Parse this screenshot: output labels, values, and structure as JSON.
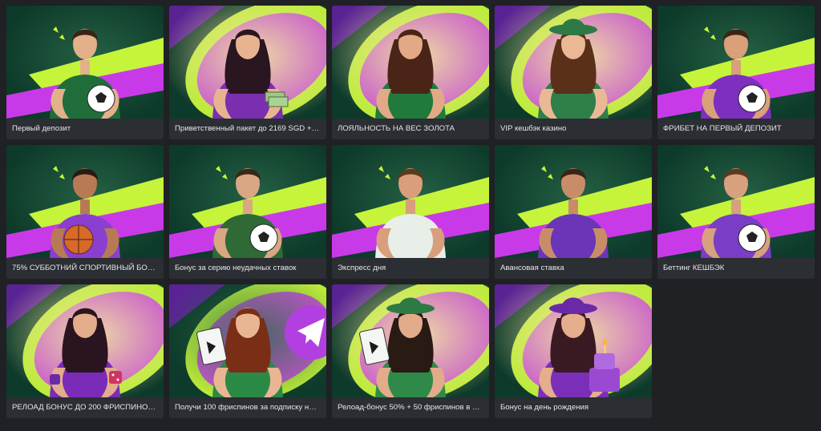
{
  "promotions": [
    {
      "title": "Первый депозит",
      "theme": "green",
      "figure": "male",
      "prop": "soccer-ball",
      "skin": "#e2b08b",
      "hair": "#3a2415",
      "outfit": "#1f6e3a"
    },
    {
      "title": "Приветственный пакет до 2169 SGD + 1...",
      "theme": "purple",
      "figure": "female",
      "prop": "cash",
      "skin": "#e8b48f",
      "hair": "#2a1620",
      "outfit": "#7a2fb0"
    },
    {
      "title": "ЛОЯЛЬНОСТЬ НА ВЕС ЗОЛОТА",
      "theme": "purple",
      "figure": "female",
      "prop": "none",
      "skin": "#e2a986",
      "hair": "#4a2416",
      "outfit": "#1f7a3c"
    },
    {
      "title": "VIP кешбэк казино",
      "theme": "purple",
      "figure": "female-hat",
      "prop": "none",
      "skin": "#ebb896",
      "hair": "#5a3018",
      "outfit": "#2e7f48"
    },
    {
      "title": "ФРИБЕТ НА ПЕРВЫЙ ДЕПОЗИТ",
      "theme": "green",
      "figure": "male",
      "prop": "volleyball",
      "skin": "#d9a07a",
      "hair": "#3b2413",
      "outfit": "#7d2fc0"
    },
    {
      "title": "75% СУББОТНИЙ СПОРТИВНЫЙ БОНУС",
      "theme": "green",
      "figure": "male",
      "prop": "basketball",
      "skin": "#b87a55",
      "hair": "#2a1a10",
      "outfit": "#8a3fd0"
    },
    {
      "title": "Бонус за серию неудачных ставок",
      "theme": "green",
      "figure": "male",
      "prop": "soccer-ball",
      "skin": "#d9a784",
      "hair": "#3a2817",
      "outfit": "#2f6a36"
    },
    {
      "title": "Экспресс дня",
      "theme": "green",
      "figure": "male",
      "prop": "none",
      "skin": "#d99e7c",
      "hair": "#5a3a1e",
      "outfit": "#e8eee8"
    },
    {
      "title": "Авансовая ставка",
      "theme": "green",
      "figure": "male",
      "prop": "none",
      "skin": "#c88d68",
      "hair": "#3a2415",
      "outfit": "#6a35b8"
    },
    {
      "title": "Беттинг КЕШБЭК",
      "theme": "green",
      "figure": "male",
      "prop": "soccer-ball",
      "skin": "#d7a07e",
      "hair": "#5a3a22",
      "outfit": "#7a3dc5"
    },
    {
      "title": "РЕЛОАД БОНУС ДО 200 ФРИСПИНОВ В ...",
      "theme": "purple",
      "figure": "female",
      "prop": "dice",
      "skin": "#e3ad8c",
      "hair": "#2a1420",
      "outfit": "#7a2cb8"
    },
    {
      "title": "Получи 100 фриспинов за подписку на ...",
      "theme": "telegram",
      "figure": "female",
      "prop": "card",
      "skin": "#e9b694",
      "hair": "#7a2e16",
      "outfit": "#2a8a45"
    },
    {
      "title": "Релоад-бонус 50% + 50 фриспинов в сре...",
      "theme": "purple",
      "figure": "female-hat",
      "prop": "card",
      "skin": "#e2ac8a",
      "hair": "#2a1a14",
      "outfit": "#2f8a4a"
    },
    {
      "title": "Бонус на день рождения",
      "theme": "purple",
      "figure": "female-hat",
      "prop": "cake",
      "skin": "#e5ae8c",
      "hair": "#3a1a22",
      "outfit": "#7b2fb8"
    }
  ],
  "colors": {
    "page_bg": "#1f2124",
    "card_caption_bg": "#2b2e33",
    "caption_text": "#e6e7ea",
    "bg_dark_green": "#0d3a2a",
    "lime": "#c6f43a",
    "magenta": "#c83ae8",
    "purple": "#5a2394"
  }
}
